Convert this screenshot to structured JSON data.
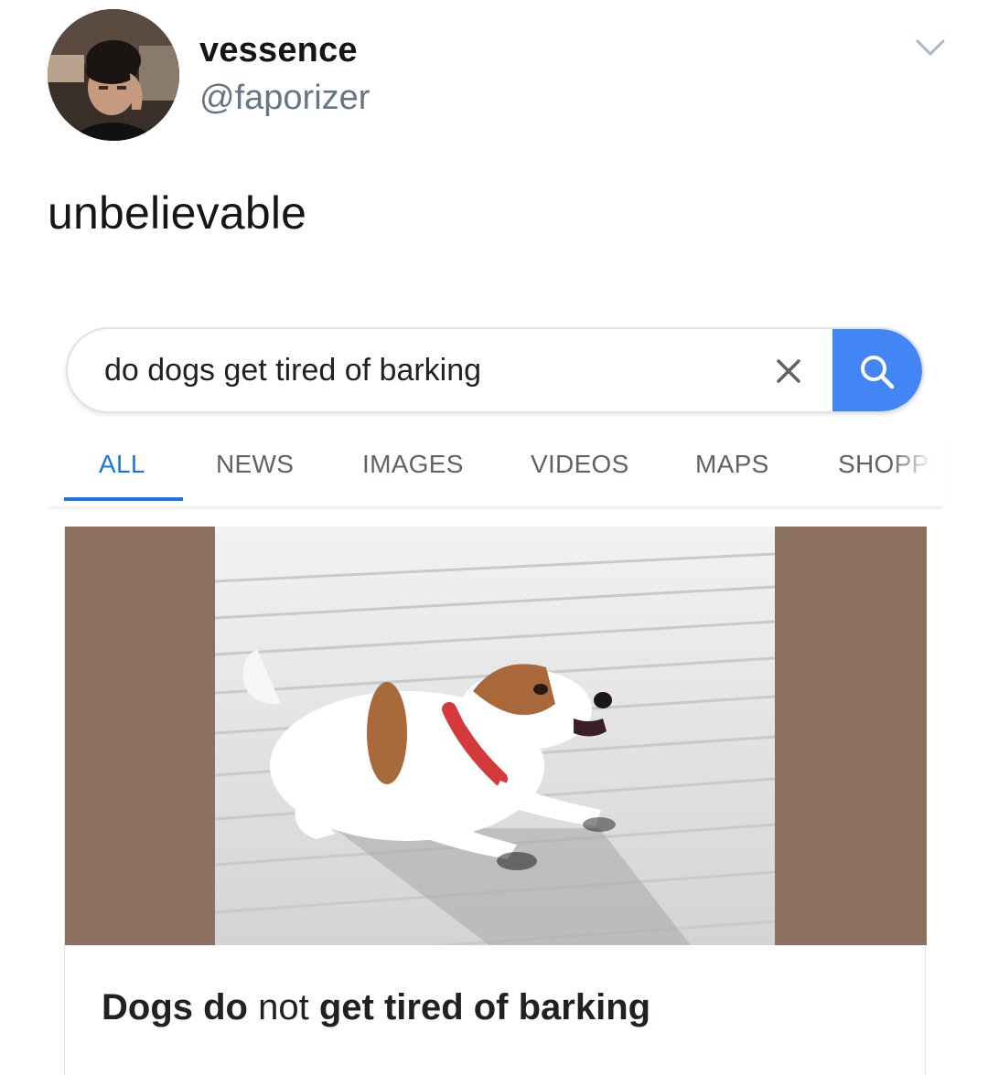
{
  "tweet": {
    "display_name": "vessence",
    "handle": "@faporizer",
    "text": "unbelievable",
    "menu_icon": "chevron-down-icon",
    "avatar_icon": "avatar"
  },
  "search": {
    "query": "do dogs get tired of barking",
    "clear_icon": "close-icon",
    "search_icon": "search-icon",
    "accent_color": "#4285f4"
  },
  "tabs": [
    {
      "label": "ALL",
      "active": true
    },
    {
      "label": "NEWS",
      "active": false
    },
    {
      "label": "IMAGES",
      "active": false
    },
    {
      "label": "VIDEOS",
      "active": false
    },
    {
      "label": "MAPS",
      "active": false
    },
    {
      "label": "SHOPPI",
      "active": false
    }
  ],
  "result": {
    "title_part1": "Dogs do",
    "title_part2": "not",
    "title_part3": "get tired of barking",
    "image_background": "#8d7160"
  }
}
